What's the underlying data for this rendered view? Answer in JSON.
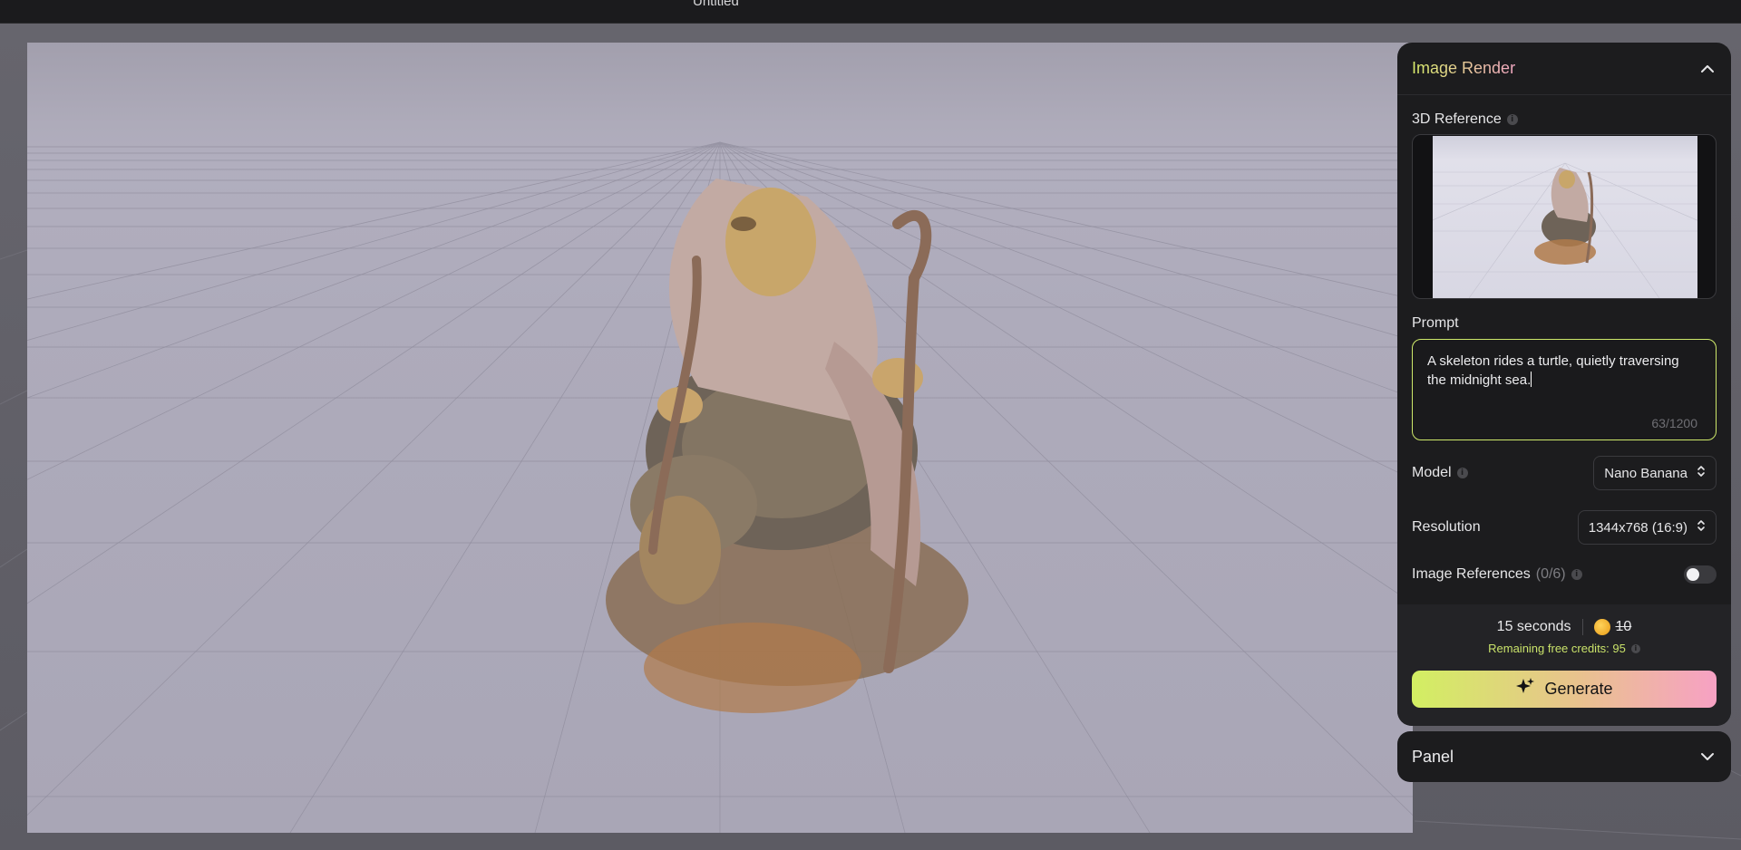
{
  "topbar": {
    "document_title": "Untitled"
  },
  "image_render": {
    "title": "Image Render",
    "reference": {
      "label": "3D Reference"
    },
    "prompt": {
      "label": "Prompt",
      "value": "A skeleton rides a turtle, quietly traversing the midnight sea.",
      "char_count": "63/1200"
    },
    "model": {
      "label": "Model",
      "selected": "Nano Banana"
    },
    "resolution": {
      "label": "Resolution",
      "selected": "1344x768 (16:9)"
    },
    "image_references": {
      "label": "Image References",
      "count": "(0/6)",
      "enabled": false
    },
    "cost": {
      "time": "15 seconds",
      "credits_cost": "10",
      "remaining": "Remaining free credits: 95"
    },
    "generate_label": "Generate"
  },
  "panel": {
    "title": "Panel"
  },
  "colors": {
    "accent_lime": "#d2ef62",
    "accent_pink": "#f7a1c4",
    "panel_bg": "#1c1c1e"
  },
  "icons": {
    "collapse": "chevron-up-icon",
    "expand": "chevron-down-icon",
    "info": "info-icon",
    "select": "chevron-updown-icon",
    "coin": "coin-icon",
    "generate": "sparkle-icon"
  }
}
